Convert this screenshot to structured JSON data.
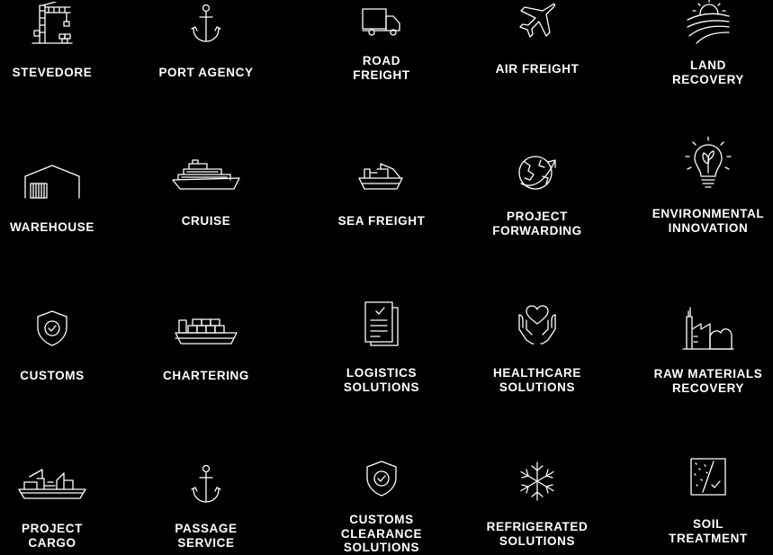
{
  "services": [
    {
      "label": "STEVEDORE",
      "icon": "crane-icon"
    },
    {
      "label": "PORT AGENCY",
      "icon": "anchor-icon"
    },
    {
      "label": "ROAD\nFREIGHT",
      "icon": "truck-icon"
    },
    {
      "label": "AIR FREIGHT",
      "icon": "airplane-icon"
    },
    {
      "label": "LAND\nRECOVERY",
      "icon": "sunrise-field-icon"
    },
    {
      "label": "WAREHOUSE",
      "icon": "warehouse-icon"
    },
    {
      "label": "CRUISE",
      "icon": "cruise-ship-icon"
    },
    {
      "label": "SEA FREIGHT",
      "icon": "cargo-ship-icon"
    },
    {
      "label": "PROJECT\nFORWARDING",
      "icon": "globe-arrow-icon"
    },
    {
      "label": "ENVIRONMENTAL\nINNOVATION",
      "icon": "lightbulb-leaf-icon"
    },
    {
      "label": "CUSTOMS",
      "icon": "shield-check-icon"
    },
    {
      "label": "CHARTERING",
      "icon": "container-ship-icon"
    },
    {
      "label": "LOGISTICS\nSOLUTIONS",
      "icon": "documents-icon"
    },
    {
      "label": "HEALTHCARE\nSOLUTIONS",
      "icon": "hands-heart-icon"
    },
    {
      "label": "RAW MATERIALS\nRECOVERY",
      "icon": "factory-icon"
    },
    {
      "label": "PROJECT\nCARGO",
      "icon": "project-cargo-ship-icon"
    },
    {
      "label": "PASSAGE\nSERVICE",
      "icon": "anchor-icon"
    },
    {
      "label": "CUSTOMS\nCLEARANCE\nSOLUTIONS",
      "icon": "shield-check-icon"
    },
    {
      "label": "REFRIGERATED\nSOLUTIONS",
      "icon": "snowflake-icon"
    },
    {
      "label": "SOIL\nTREATMENT",
      "icon": "soil-sample-icon"
    }
  ]
}
